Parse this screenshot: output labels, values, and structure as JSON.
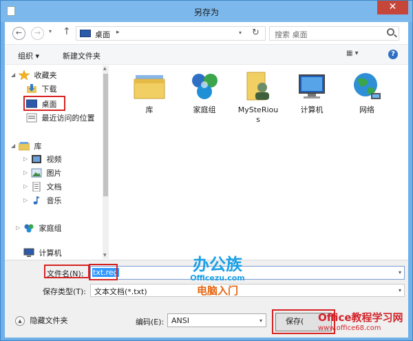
{
  "window": {
    "title": "另存为",
    "close_glyph": "✕"
  },
  "nav": {
    "back_glyph": "←",
    "forward_glyph": "→",
    "recent_glyph": "▾",
    "up_glyph": "↑",
    "address_crumb": "桌面",
    "address_arrow": "▸",
    "address_dropdown": "▾",
    "refresh_glyph": "↻",
    "search_placeholder": "搜索 桌面"
  },
  "toolbar": {
    "organize": "组织 ▾",
    "new_folder": "新建文件夹",
    "view_glyph": "▦ ▾",
    "help_glyph": "?"
  },
  "sidebar": {
    "favorites": {
      "label": "收藏夹",
      "items": [
        "下载",
        "桌面",
        "最近访问的位置"
      ]
    },
    "libraries": {
      "label": "库",
      "items": [
        "视频",
        "图片",
        "文档",
        "音乐"
      ]
    },
    "homegroup": "家庭组",
    "computer": "计算机",
    "tree_glyph_open": "◢",
    "tree_glyph_closed": "▷"
  },
  "content": {
    "items": [
      {
        "label": "库",
        "icon": "library-icon"
      },
      {
        "label": "家庭组",
        "icon": "homegroup-icon"
      },
      {
        "label": "MySteRious",
        "icon": "user-folder-icon"
      },
      {
        "label": "计算机",
        "icon": "computer-icon"
      },
      {
        "label": "网络",
        "icon": "network-icon"
      }
    ]
  },
  "form": {
    "filename_label": "文件名(N):",
    "filename_value": "txt.reg",
    "filetype_label": "保存类型(T):",
    "filetype_value": "文本文档(*.txt)",
    "hide_folders": "隐藏文件夹",
    "encoding_label": "编码(E):",
    "encoding_value": "ANSI",
    "save_button": "保存(",
    "dropdown_glyph": "▾"
  },
  "watermark": {
    "logo_main": "办公族",
    "logo_url": "Officezu.com",
    "logo_sub": "电脑入门",
    "corner_main": "Office教程学习网",
    "corner_url": "www.office68.com"
  },
  "colors": {
    "titlebar": "#7cb8ec",
    "close": "#c7463a",
    "highlight_box": "#d62121",
    "selection": "#3399ff"
  }
}
